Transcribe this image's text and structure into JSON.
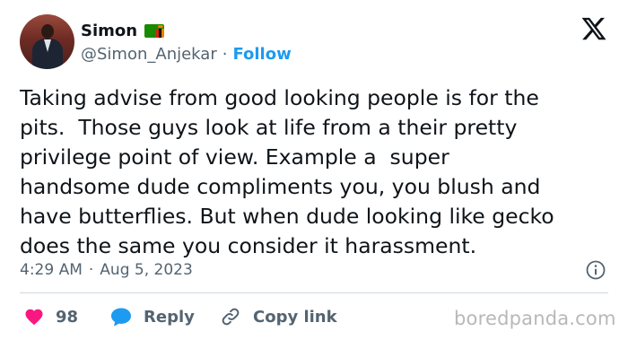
{
  "tweet": {
    "author": {
      "display_name": "Simon",
      "handle": "@Simon_Anjekar",
      "follow_label": "Follow",
      "flag": "zambia-flag"
    },
    "separator": "·",
    "text": "Taking advise from good looking people is for the\npits.  Those guys look at life from a their pretty\nprivilege point of view. Example a  super\nhandsome dude compliments you, you blush and\nhave butterflies. But when dude looking like gecko\ndoes the same you consider it harassment.",
    "time": "4:29 AM",
    "date": "Aug 5, 2023",
    "likes": "98",
    "reply_label": "Reply",
    "copy_link_label": "Copy link"
  },
  "watermark": "boredpanda.com",
  "colors": {
    "accent": "#1d9bf0",
    "like": "#f91880",
    "muted": "#536471",
    "text": "#0f1419"
  },
  "icons": {
    "platform_logo": "x-logo-icon",
    "info": "info-icon",
    "like": "heart-icon",
    "reply": "reply-bubble-icon",
    "copy": "link-icon"
  }
}
